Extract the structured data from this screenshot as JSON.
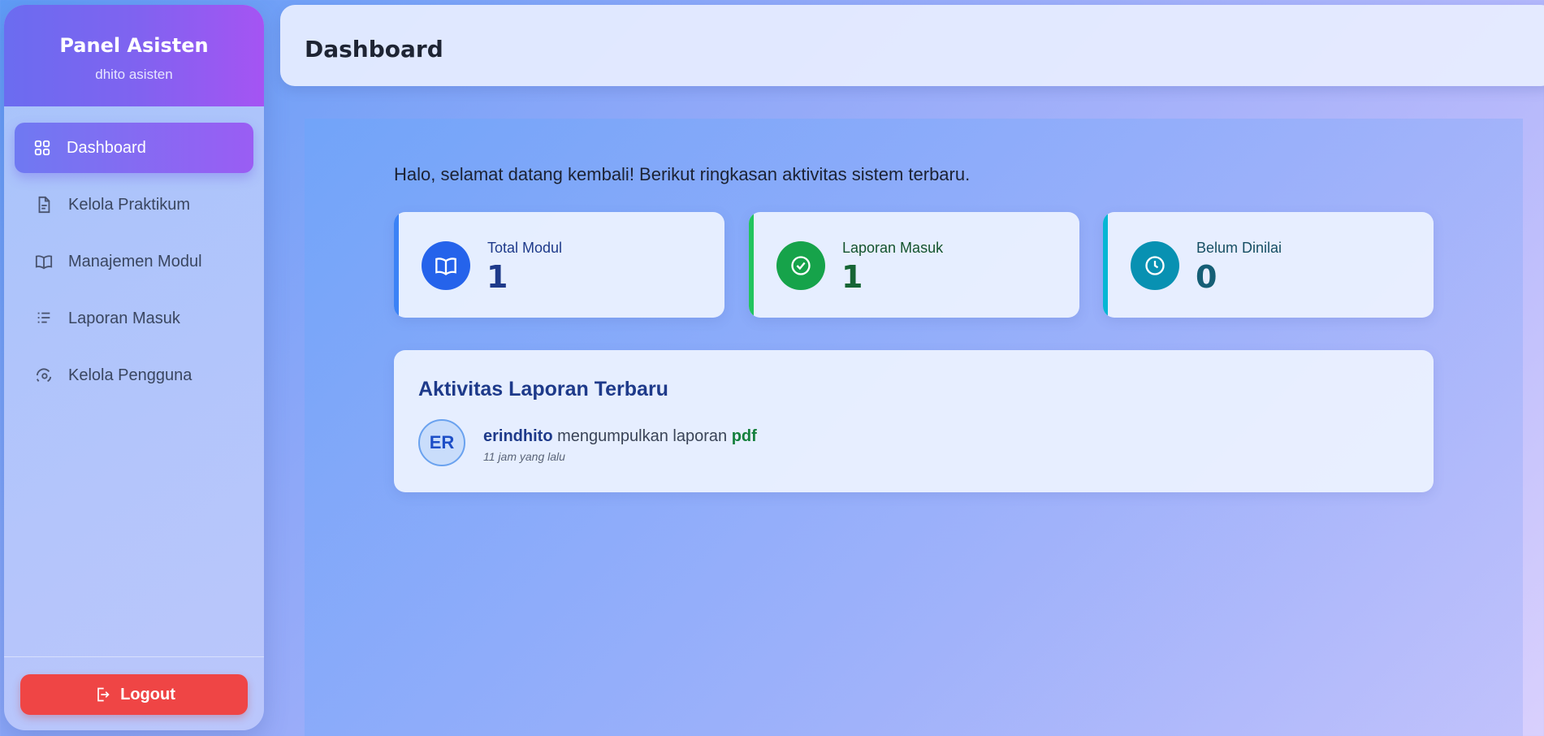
{
  "sidebar": {
    "title": "Panel Asisten",
    "subtitle": "dhito asisten",
    "items": [
      {
        "label": "Dashboard",
        "icon": "grid-icon",
        "active": true
      },
      {
        "label": "Kelola Praktikum",
        "icon": "document-icon",
        "active": false
      },
      {
        "label": "Manajemen Modul",
        "icon": "book-icon",
        "active": false
      },
      {
        "label": "Laporan Masuk",
        "icon": "report-list-icon",
        "active": false
      },
      {
        "label": "Kelola Pengguna",
        "icon": "user-cog-icon",
        "active": false
      }
    ],
    "logout_label": "Logout"
  },
  "header": {
    "title": "Dashboard"
  },
  "main": {
    "welcome": "Halo, selamat datang kembali! Berikut ringkasan aktivitas sistem terbaru.",
    "stats": [
      {
        "label": "Total Modul",
        "value": "1",
        "icon": "book-icon",
        "color": "#2563eb"
      },
      {
        "label": "Laporan Masuk",
        "value": "1",
        "icon": "check-circle-icon",
        "color": "#16a34a"
      },
      {
        "label": "Belum Dinilai",
        "value": "0",
        "icon": "clock-icon",
        "color": "#0891b2"
      }
    ],
    "activity": {
      "title": "Aktivitas Laporan Terbaru",
      "items": [
        {
          "initials": "ER",
          "user": "erindhito",
          "action": "mengumpulkan laporan",
          "file": "pdf",
          "time": "11 jam yang lalu"
        }
      ]
    }
  },
  "colors": {
    "accent": "#7c5cf2",
    "logout": "#ef4545",
    "stat_blue": "#2563eb",
    "stat_green": "#16a34a",
    "stat_cyan": "#0891b2"
  }
}
